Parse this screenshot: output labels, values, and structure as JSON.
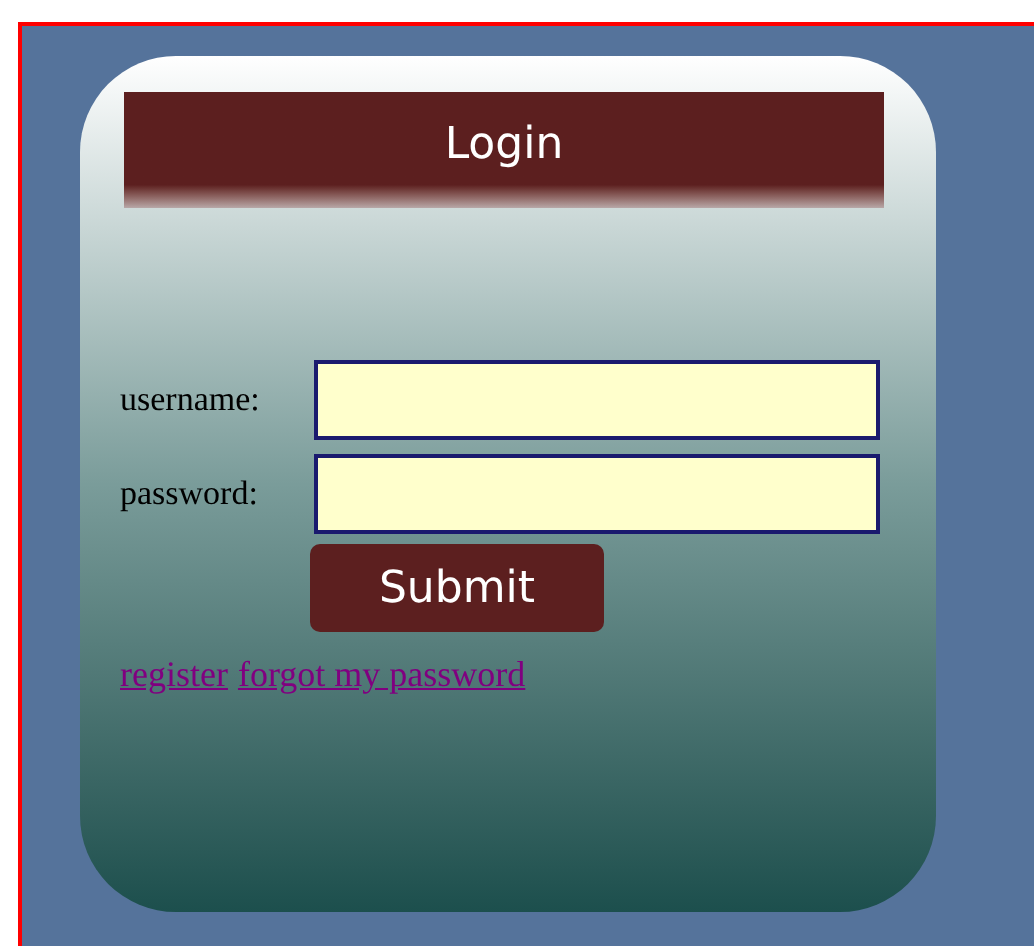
{
  "header": {
    "title": "Login"
  },
  "fields": [
    {
      "label": "username:"
    },
    {
      "label": "password:"
    }
  ],
  "submit": {
    "label": "Submit"
  },
  "links": [
    {
      "label": "register"
    },
    {
      "label": "forgot my password"
    }
  ]
}
